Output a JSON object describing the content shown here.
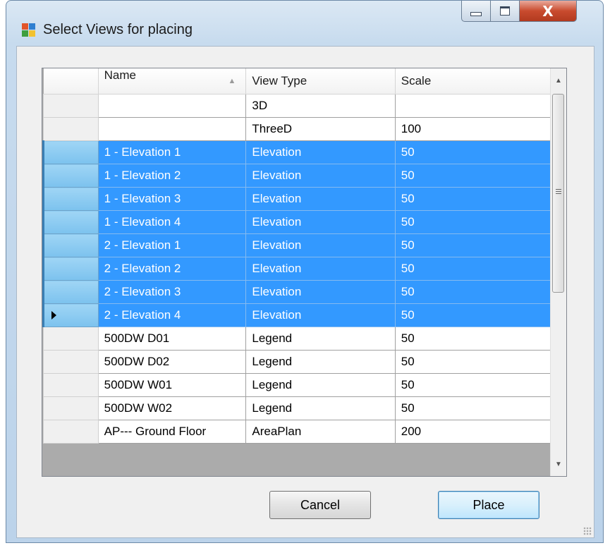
{
  "window": {
    "title": "Select Views for placing",
    "minimize_icon": "minimize-icon",
    "maximize_icon": "maximize-icon",
    "close_icon": "close-icon",
    "close_glyph": "X"
  },
  "grid": {
    "columns": [
      "Name",
      "View Type",
      "Scale"
    ],
    "sorted_column": "Name",
    "sort_direction": "ascending",
    "rows": [
      {
        "name": "",
        "view_type": "3D",
        "scale": "",
        "selected": false,
        "current": false
      },
      {
        "name": "",
        "view_type": "ThreeD",
        "scale": "100",
        "selected": false,
        "current": false
      },
      {
        "name": "1 - Elevation 1",
        "view_type": "Elevation",
        "scale": "50",
        "selected": true,
        "current": false
      },
      {
        "name": "1 - Elevation 2",
        "view_type": "Elevation",
        "scale": "50",
        "selected": true,
        "current": false
      },
      {
        "name": "1 - Elevation 3",
        "view_type": "Elevation",
        "scale": "50",
        "selected": true,
        "current": false
      },
      {
        "name": "1 - Elevation 4",
        "view_type": "Elevation",
        "scale": "50",
        "selected": true,
        "current": false
      },
      {
        "name": "2 - Elevation 1",
        "view_type": "Elevation",
        "scale": "50",
        "selected": true,
        "current": false
      },
      {
        "name": "2 - Elevation 2",
        "view_type": "Elevation",
        "scale": "50",
        "selected": true,
        "current": false
      },
      {
        "name": "2 - Elevation 3",
        "view_type": "Elevation",
        "scale": "50",
        "selected": true,
        "current": false
      },
      {
        "name": "2 - Elevation 4",
        "view_type": "Elevation",
        "scale": "50",
        "selected": true,
        "current": true
      },
      {
        "name": "500DW D01",
        "view_type": "Legend",
        "scale": "50",
        "selected": false,
        "current": false
      },
      {
        "name": "500DW D02",
        "view_type": "Legend",
        "scale": "50",
        "selected": false,
        "current": false
      },
      {
        "name": "500DW W01",
        "view_type": "Legend",
        "scale": "50",
        "selected": false,
        "current": false
      },
      {
        "name": "500DW W02",
        "view_type": "Legend",
        "scale": "50",
        "selected": false,
        "current": false
      },
      {
        "name": "AP--- Ground Floor",
        "view_type": "AreaPlan",
        "scale": "200",
        "selected": false,
        "current": false
      }
    ]
  },
  "buttons": {
    "cancel": "Cancel",
    "place": "Place"
  },
  "colors": {
    "selection": "#3399ff",
    "selection_text": "#ffffff"
  }
}
